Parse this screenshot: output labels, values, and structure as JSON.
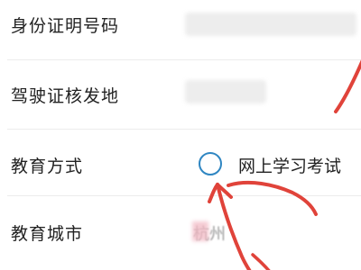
{
  "form": {
    "rows": [
      {
        "label": "身份证明号码"
      },
      {
        "label": "驾驶证核发地"
      },
      {
        "label": "教育方式"
      },
      {
        "label": "教育城市"
      }
    ],
    "education_method_option": "网上学习考试",
    "education_city_value": "杭州"
  },
  "colors": {
    "radio_border": "#2f86c2",
    "annotation_red": "#e0433a"
  },
  "icons": [
    "radio-circle-icon",
    "red-arrow-annotation"
  ]
}
